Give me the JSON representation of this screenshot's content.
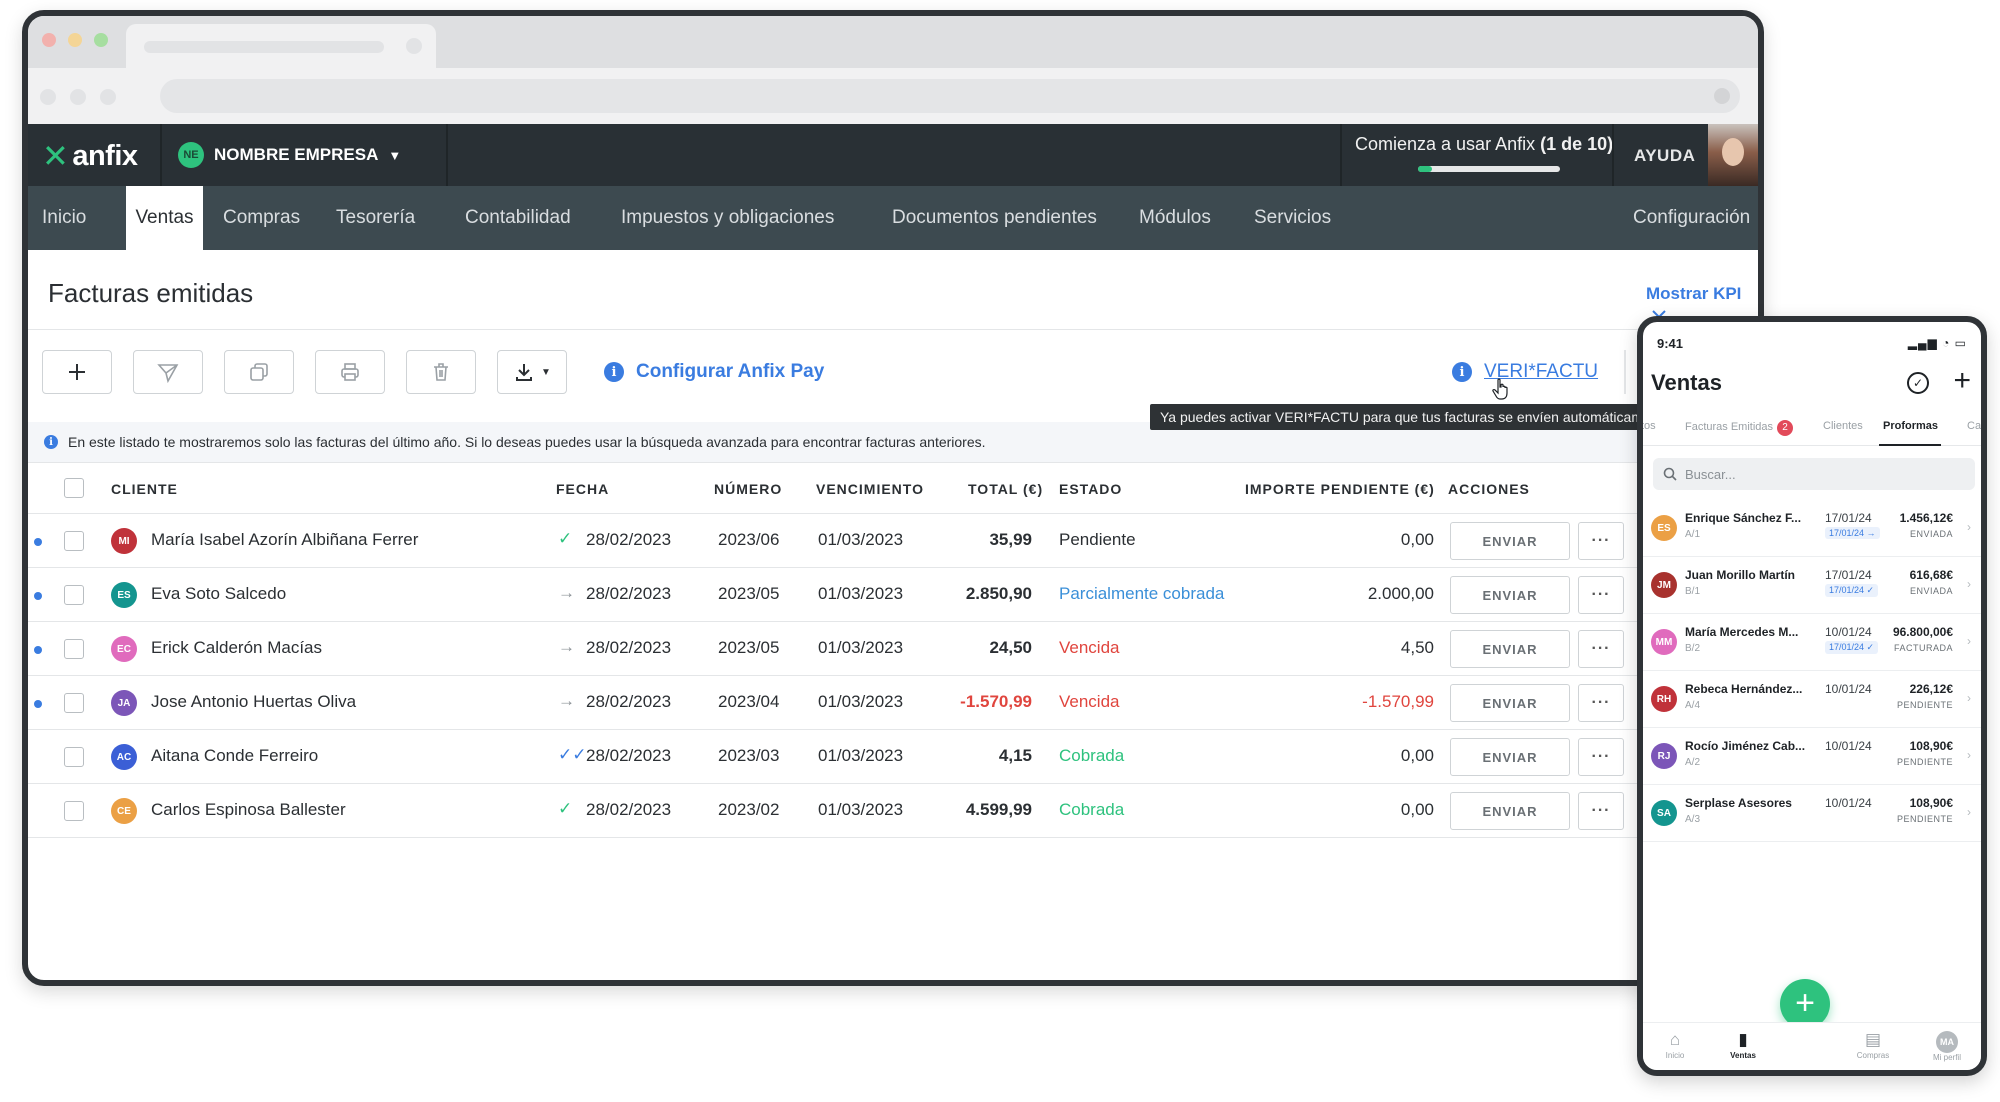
{
  "app": {
    "logo_text": "anfix",
    "company_initials": "NE",
    "company_name": "NOMBRE EMPRESA",
    "onboarding_text": "Comienza a usar Anfix",
    "onboarding_count": "(1 de 10)",
    "onboarding_progress": 0.1,
    "help_label": "AYUDA"
  },
  "nav": {
    "items": [
      {
        "label": "Inicio"
      },
      {
        "label": "Ventas"
      },
      {
        "label": "Compras"
      },
      {
        "label": "Tesorería"
      },
      {
        "label": "Contabilidad"
      },
      {
        "label": "Impuestos y obligaciones"
      },
      {
        "label": "Documentos pendientes"
      },
      {
        "label": "Módulos"
      },
      {
        "label": "Servicios"
      }
    ],
    "active": "Ventas",
    "settings_label": "Configuración"
  },
  "page": {
    "title": "Facturas emitidas",
    "kpi_label": "Mostrar KPI",
    "anfix_pay_label": "Configurar Anfix Pay",
    "verifactu_label": "VERI*FACTU",
    "tooltip": "Ya puedes activar VERI*FACTU para que tus facturas se envíen automáticamen",
    "notice": "En este listado te mostraremos solo las facturas del último año. Si lo deseas puedes usar la búsqueda avanzada para encontrar facturas anteriores."
  },
  "table": {
    "headers": {
      "client": "CLIENTE",
      "date": "FECHA",
      "number": "NÚMERO",
      "due": "VENCIMIENTO",
      "total": "TOTAL (€)",
      "status": "ESTADO",
      "pending": "IMPORTE PENDIENTE (€)",
      "actions": "ACCIONES"
    },
    "send_label": "ENVIAR",
    "more_label": "···",
    "rows": [
      {
        "unread": true,
        "initials": "MI",
        "avatar_color": "#c0323a",
        "client": "María Isabel Azorín Albiñana Ferrer",
        "send_icon": "check",
        "date": "28/02/2023",
        "number": "2023/06",
        "due": "01/03/2023",
        "total": "35,99",
        "total_color": "#2b2f33",
        "status": "Pendiente",
        "status_color": "#2b2f33",
        "pending": "0,00",
        "pending_color": "#2b2f33"
      },
      {
        "unread": true,
        "initials": "ES",
        "avatar_color": "#14958f",
        "client": "Eva Soto Salcedo",
        "send_icon": "arrow",
        "date": "28/02/2023",
        "number": "2023/05",
        "due": "01/03/2023",
        "total": "2.850,90",
        "total_color": "#2b2f33",
        "status": "Parcialmente cobrada",
        "status_color": "#3a8fd8",
        "pending": "2.000,00",
        "pending_color": "#2b2f33"
      },
      {
        "unread": true,
        "initials": "EC",
        "avatar_color": "#e06bbd",
        "client": "Erick Calderón Macías",
        "send_icon": "arrow",
        "date": "28/02/2023",
        "number": "2023/05",
        "due": "01/03/2023",
        "total": "24,50",
        "total_color": "#2b2f33",
        "status": "Vencida",
        "status_color": "#e0453e",
        "pending": "4,50",
        "pending_color": "#2b2f33"
      },
      {
        "unread": true,
        "initials": "JA",
        "avatar_color": "#7c56b8",
        "client": "Jose Antonio Huertas Oliva",
        "send_icon": "arrow",
        "date": "28/02/2023",
        "number": "2023/04",
        "due": "01/03/2023",
        "total": "-1.570,99",
        "total_color": "#e0453e",
        "status": "Vencida",
        "status_color": "#e0453e",
        "pending": "-1.570,99",
        "pending_color": "#e0453e"
      },
      {
        "unread": false,
        "initials": "AC",
        "avatar_color": "#3b5fd6",
        "client": "Aitana Conde Ferreiro",
        "send_icon": "double-check",
        "date": "28/02/2023",
        "number": "2023/03",
        "due": "01/03/2023",
        "total": "4,15",
        "total_color": "#2b2f33",
        "status": "Cobrada",
        "status_color": "#2ec27e",
        "pending": "0,00",
        "pending_color": "#2b2f33"
      },
      {
        "unread": false,
        "initials": "CE",
        "avatar_color": "#eba045",
        "client": "Carlos Espinosa Ballester",
        "send_icon": "check",
        "date": "28/02/2023",
        "number": "2023/02",
        "due": "01/03/2023",
        "total": "4.599,99",
        "total_color": "#2b2f33",
        "status": "Cobrada",
        "status_color": "#2ec27e",
        "pending": "0,00",
        "pending_color": "#2b2f33"
      }
    ]
  },
  "phone": {
    "time": "9:41",
    "title": "Ventas",
    "tabs": [
      {
        "label": "tos",
        "active": false
      },
      {
        "label": "Facturas Emitidas",
        "badge": "2",
        "active": false
      },
      {
        "label": "Clientes",
        "active": false
      },
      {
        "label": "Proformas",
        "active": true
      },
      {
        "label": "Ca",
        "active": false
      }
    ],
    "search_placeholder": "Buscar...",
    "rows": [
      {
        "initials": "ES",
        "color": "#eba045",
        "name": "Enrique Sánchez F...",
        "code": "A/1",
        "date": "17/01/24",
        "chip": "17/01/24 →",
        "amount": "1.456,12€",
        "status": "ENVIADA"
      },
      {
        "initials": "JM",
        "color": "#a8322e",
        "name": "Juan Morillo Martín",
        "code": "B/1",
        "date": "17/01/24",
        "chip": "17/01/24 ✓",
        "amount": "616,68€",
        "status": "ENVIADA"
      },
      {
        "initials": "MM",
        "color": "#e06bbd",
        "name": "María Mercedes M...",
        "code": "B/2",
        "date": "10/01/24",
        "chip": "17/01/24 ✓",
        "amount": "96.800,00€",
        "status": "FACTURADA"
      },
      {
        "initials": "RH",
        "color": "#c0323a",
        "name": "Rebeca Hernández...",
        "code": "A/4",
        "date": "10/01/24",
        "chip": "",
        "amount": "226,12€",
        "status": "PENDIENTE"
      },
      {
        "initials": "RJ",
        "color": "#7c56b8",
        "name": "Rocío Jiménez Cab...",
        "code": "A/2",
        "date": "10/01/24",
        "chip": "",
        "amount": "108,90€",
        "status": "PENDIENTE"
      },
      {
        "initials": "SA",
        "color": "#14958f",
        "name": "Serplase Asesores",
        "code": "A/3",
        "date": "10/01/24",
        "chip": "",
        "amount": "108,90€",
        "status": "PENDIENTE"
      }
    ],
    "bottom_nav": [
      {
        "label": "Inicio",
        "icon": "home-icon",
        "active": false
      },
      {
        "label": "Ventas",
        "icon": "clipboard-icon",
        "active": true
      },
      {
        "label": "Compras",
        "icon": "receipt-icon",
        "active": false
      },
      {
        "label": "Mi perfil",
        "icon": "profile-icon",
        "initials": "MA",
        "active": false
      }
    ]
  }
}
